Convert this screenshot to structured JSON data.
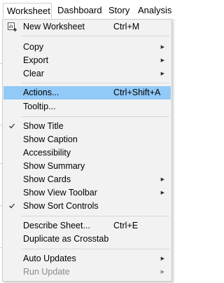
{
  "menubar": {
    "items": [
      {
        "label": "Worksheet",
        "active": true
      },
      {
        "label": "Dashboard"
      },
      {
        "label": "Story"
      },
      {
        "label": "Analysis"
      }
    ]
  },
  "menu": {
    "new_worksheet": {
      "label": "New Worksheet",
      "shortcut": "Ctrl+M",
      "icon": "new-worksheet-icon"
    },
    "copy": {
      "label": "Copy",
      "submenu": true
    },
    "export": {
      "label": "Export",
      "submenu": true
    },
    "clear": {
      "label": "Clear",
      "submenu": true
    },
    "actions": {
      "label": "Actions...",
      "shortcut": "Ctrl+Shift+A",
      "highlighted": true
    },
    "tooltip": {
      "label": "Tooltip..."
    },
    "show_title": {
      "label": "Show Title",
      "checked": true
    },
    "show_caption": {
      "label": "Show Caption"
    },
    "accessibility": {
      "label": "Accessibility"
    },
    "show_summary": {
      "label": "Show Summary"
    },
    "show_cards": {
      "label": "Show Cards",
      "submenu": true
    },
    "show_view_toolbar": {
      "label": "Show View Toolbar",
      "submenu": true
    },
    "show_sort_controls": {
      "label": "Show Sort Controls",
      "checked": true
    },
    "describe_sheet": {
      "label": "Describe Sheet...",
      "shortcut": "Ctrl+E"
    },
    "duplicate_crosstab": {
      "label": "Duplicate as Crosstab"
    },
    "auto_updates": {
      "label": "Auto Updates",
      "submenu": true
    },
    "run_update": {
      "label": "Run Update",
      "submenu": true,
      "disabled": true
    }
  },
  "colors": {
    "highlight": "#91c9f7",
    "menu_background": "#f2f2f2",
    "disabled_text": "#8a8a8a"
  }
}
